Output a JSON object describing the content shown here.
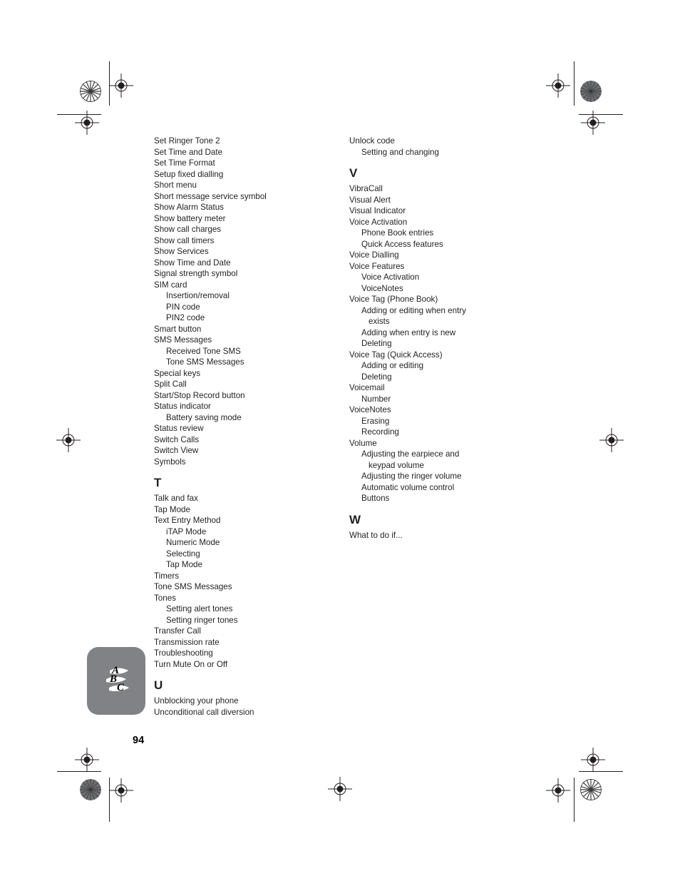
{
  "document": {
    "page_number": "94",
    "thumb_tab_icon": "abc-icon"
  },
  "index": {
    "left_column": [
      {
        "level": 1,
        "text": "Set Ringer Tone 2"
      },
      {
        "level": 1,
        "text": "Set Time and Date"
      },
      {
        "level": 1,
        "text": "Set Time Format"
      },
      {
        "level": 1,
        "text": "Setup fixed dialling"
      },
      {
        "level": 1,
        "text": "Short menu"
      },
      {
        "level": 1,
        "text": "Short message service symbol"
      },
      {
        "level": 1,
        "text": "Show Alarm Status"
      },
      {
        "level": 1,
        "text": "Show battery meter"
      },
      {
        "level": 1,
        "text": "Show call charges"
      },
      {
        "level": 1,
        "text": "Show call timers"
      },
      {
        "level": 1,
        "text": "Show Services"
      },
      {
        "level": 1,
        "text": "Show Time and Date"
      },
      {
        "level": 1,
        "text": "Signal strength symbol"
      },
      {
        "level": 1,
        "text": "SIM card"
      },
      {
        "level": 2,
        "text": "Insertion/removal"
      },
      {
        "level": 2,
        "text": "PIN code"
      },
      {
        "level": 2,
        "text": "PIN2 code"
      },
      {
        "level": 1,
        "text": "Smart button"
      },
      {
        "level": 1,
        "text": "SMS Messages"
      },
      {
        "level": 2,
        "text": "Received Tone SMS"
      },
      {
        "level": 2,
        "text": "Tone SMS Messages"
      },
      {
        "level": 1,
        "text": "Special keys"
      },
      {
        "level": 1,
        "text": "Split Call"
      },
      {
        "level": 1,
        "text": "Start/Stop Record button"
      },
      {
        "level": 1,
        "text": "Status indicator"
      },
      {
        "level": 2,
        "text": "Battery saving mode"
      },
      {
        "level": 1,
        "text": "Status review"
      },
      {
        "level": 1,
        "text": "Switch Calls"
      },
      {
        "level": 1,
        "text": "Switch View"
      },
      {
        "level": 1,
        "text": "Symbols"
      },
      {
        "level": 0,
        "text": "T"
      },
      {
        "level": 1,
        "text": "Talk and fax"
      },
      {
        "level": 1,
        "text": "Tap Mode"
      },
      {
        "level": 1,
        "text": "Text Entry Method"
      },
      {
        "level": 2,
        "text": "iTAP Mode"
      },
      {
        "level": 2,
        "text": "Numeric Mode"
      },
      {
        "level": 2,
        "text": "Selecting"
      },
      {
        "level": 2,
        "text": "Tap Mode"
      },
      {
        "level": 1,
        "text": "Timers"
      },
      {
        "level": 1,
        "text": "Tone SMS Messages"
      },
      {
        "level": 1,
        "text": "Tones"
      },
      {
        "level": 2,
        "text": "Setting alert tones"
      },
      {
        "level": 2,
        "text": "Setting ringer tones"
      },
      {
        "level": 1,
        "text": "Transfer Call"
      },
      {
        "level": 1,
        "text": "Transmission rate"
      },
      {
        "level": 1,
        "text": "Troubleshooting"
      },
      {
        "level": 1,
        "text": "Turn Mute On or Off"
      },
      {
        "level": 0,
        "text": "U"
      },
      {
        "level": 1,
        "text": "Unblocking your phone"
      },
      {
        "level": 1,
        "text": "Unconditional call diversion"
      }
    ],
    "right_column": [
      {
        "level": 1,
        "text": "Unlock code"
      },
      {
        "level": 2,
        "text": "Setting and changing"
      },
      {
        "level": 0,
        "text": "V"
      },
      {
        "level": 1,
        "text": "VibraCall"
      },
      {
        "level": 1,
        "text": "Visual Alert"
      },
      {
        "level": 1,
        "text": "Visual Indicator"
      },
      {
        "level": 1,
        "text": "Voice Activation"
      },
      {
        "level": 2,
        "text": "Phone Book entries"
      },
      {
        "level": 2,
        "text": "Quick Access features"
      },
      {
        "level": 1,
        "text": "Voice Dialling"
      },
      {
        "level": 1,
        "text": "Voice Features"
      },
      {
        "level": 2,
        "text": "Voice Activation"
      },
      {
        "level": 2,
        "text": "VoiceNotes"
      },
      {
        "level": 1,
        "text": "Voice Tag (Phone Book)"
      },
      {
        "level": 2,
        "text": "Adding or editing when entry"
      },
      {
        "level": 3,
        "text": "exists"
      },
      {
        "level": 2,
        "text": "Adding when entry is new"
      },
      {
        "level": 2,
        "text": "Deleting"
      },
      {
        "level": 1,
        "text": "Voice Tag (Quick Access)"
      },
      {
        "level": 2,
        "text": "Adding or editing"
      },
      {
        "level": 2,
        "text": "Deleting"
      },
      {
        "level": 1,
        "text": "Voicemail"
      },
      {
        "level": 2,
        "text": "Number"
      },
      {
        "level": 1,
        "text": "VoiceNotes"
      },
      {
        "level": 2,
        "text": "Erasing"
      },
      {
        "level": 2,
        "text": "Recording"
      },
      {
        "level": 1,
        "text": "Volume"
      },
      {
        "level": 2,
        "text": "Adjusting the earpiece and"
      },
      {
        "level": 3,
        "text": "keypad volume"
      },
      {
        "level": 2,
        "text": "Adjusting the ringer volume"
      },
      {
        "level": 2,
        "text": "Automatic volume control"
      },
      {
        "level": 2,
        "text": "Buttons"
      },
      {
        "level": 0,
        "text": "W"
      },
      {
        "level": 1,
        "text": "What to do if..."
      }
    ]
  },
  "print_marks": {
    "registration_icon": "registration-crosshair-icon",
    "star_target_icon": "halftone-star-target-icon",
    "tab_color": "#808285",
    "ink_color": "#231f20"
  }
}
